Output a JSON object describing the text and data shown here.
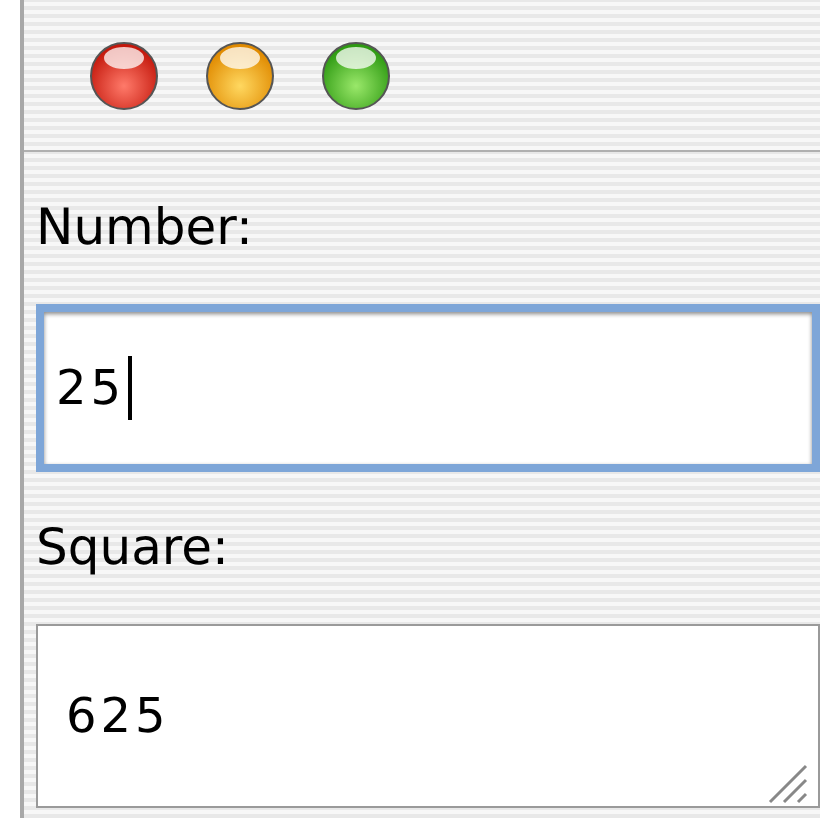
{
  "fields": [
    {
      "label": "Number:",
      "value": "25",
      "focused": true
    },
    {
      "label": "Square:",
      "value": "625",
      "focused": false
    }
  ]
}
